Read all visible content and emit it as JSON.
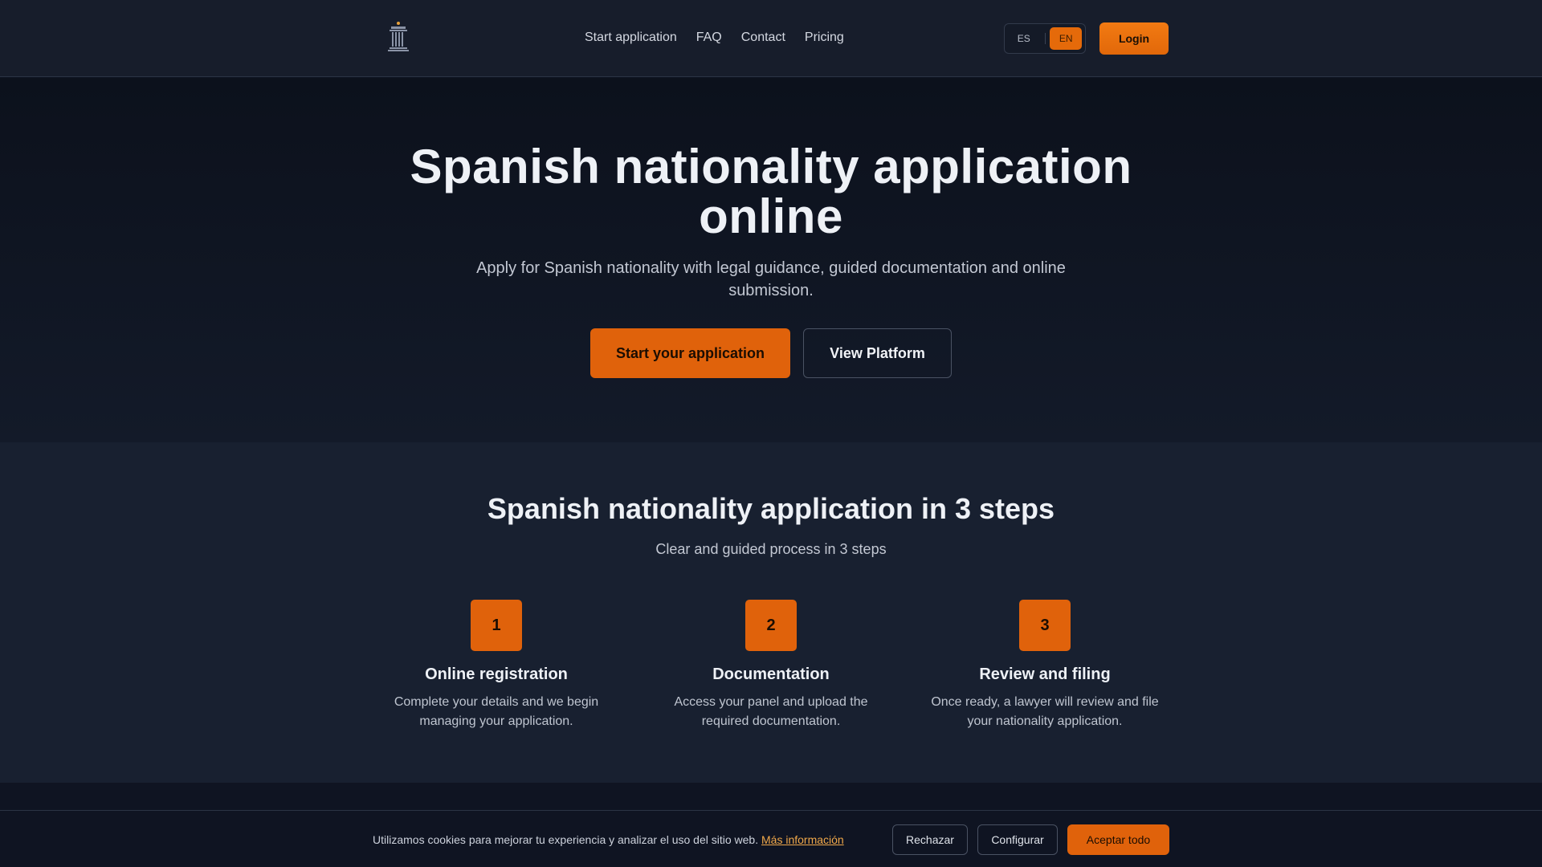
{
  "header": {
    "logo_icon": "column-pillar-icon",
    "nav": [
      {
        "label": "Start application"
      },
      {
        "label": "FAQ"
      },
      {
        "label": "Contact"
      },
      {
        "label": "Pricing"
      }
    ],
    "languages": [
      {
        "code": "ES",
        "active": false
      },
      {
        "code": "EN",
        "active": true
      }
    ],
    "login_label": "Login"
  },
  "hero": {
    "title_line1": "Spanish nationality application",
    "title_line2": "online",
    "subtitle": "Apply for Spanish nationality with legal guidance, guided documentation and online submission.",
    "primary_cta": "Start your application",
    "secondary_cta": "View Platform"
  },
  "steps": {
    "title": "Spanish nationality application in 3 steps",
    "subtitle": "Clear and guided process in 3 steps",
    "items": [
      {
        "number": "1",
        "title": "Online registration",
        "desc": "Complete your details and we begin managing your application."
      },
      {
        "number": "2",
        "title": "Documentation",
        "desc": "Access your panel and upload the required documentation."
      },
      {
        "number": "3",
        "title": "Review and filing",
        "desc": "Once ready, a lawyer will review and file your nationality application."
      }
    ]
  },
  "cookies": {
    "text": "Utilizamos cookies para mejorar tu experiencia y analizar el uso del sitio web.",
    "link": "Más información",
    "reject": "Rechazar",
    "configure": "Configurar",
    "accept": "Aceptar todo"
  },
  "colors": {
    "accent": "#e0620b",
    "header_bg": "#171d2b",
    "page_bg": "#0f1422",
    "steps_bg": "#182030"
  }
}
